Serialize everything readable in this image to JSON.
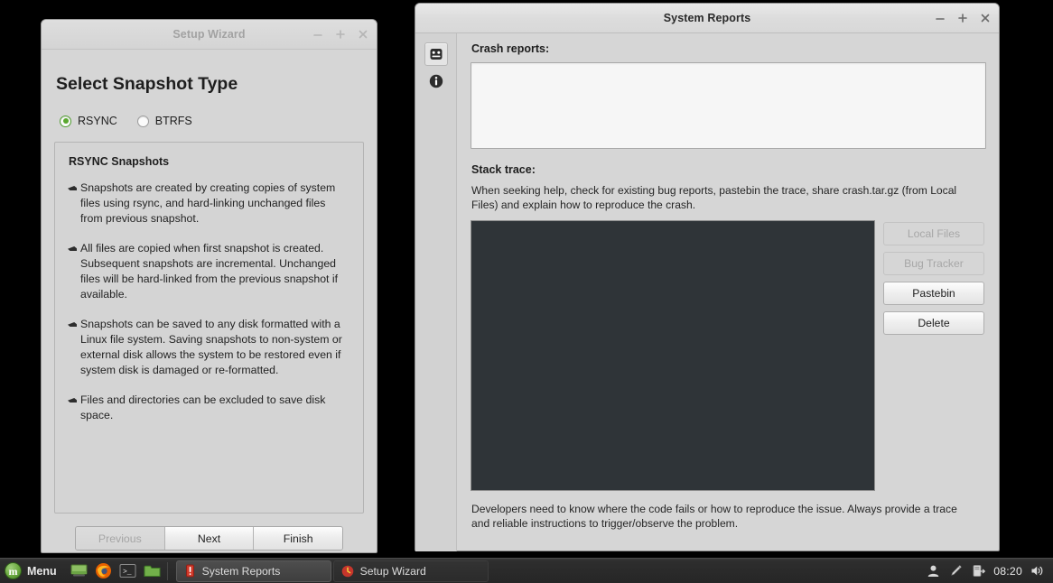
{
  "setup_wizard": {
    "title": "Setup Wizard",
    "heading": "Select Snapshot Type",
    "radios": [
      {
        "label": "RSYNC",
        "selected": true
      },
      {
        "label": "BTRFS",
        "selected": false
      }
    ],
    "info_title": "RSYNC Snapshots",
    "info_paragraphs": [
      "Snapshots are created by creating copies of system files using rsync, and hard-linking unchanged files from previous snapshot.",
      "All files are copied when first snapshot is created. Subsequent snapshots are incremental. Unchanged files will be hard-linked from the previous snapshot if available.",
      "Snapshots can be saved to any disk formatted with a Linux file system. Saving snapshots to non-system or external disk allows the system to be restored even if system disk is damaged or re-formatted.",
      "Files and directories can be excluded to save disk space."
    ],
    "buttons": [
      {
        "label": "Previous",
        "disabled": true
      },
      {
        "label": "Next",
        "disabled": false
      },
      {
        "label": "Finish",
        "disabled": false
      }
    ],
    "window_controls": {
      "minimize": "minimize-icon",
      "maximize": "maximize-icon",
      "close": "close-icon"
    }
  },
  "system_reports": {
    "title": "System Reports",
    "sidebar": [
      {
        "name": "crash-reports-icon",
        "selected": true
      },
      {
        "name": "info-icon",
        "selected": false
      }
    ],
    "crash_reports_label": "Crash reports:",
    "crash_reports_items": [],
    "stack_trace_label": "Stack trace:",
    "help_text": "When seeking help, check for existing bug reports, pastebin the trace, share crash.tar.gz (from Local Files) and explain how to reproduce the crash.",
    "trace_content": "",
    "buttons": [
      {
        "label": "Local Files",
        "disabled": true
      },
      {
        "label": "Bug Tracker",
        "disabled": true
      },
      {
        "label": "Pastebin",
        "disabled": false
      },
      {
        "label": "Delete",
        "disabled": false
      }
    ],
    "footer_text": "Developers need to know where the code fails or how to reproduce the issue. Always provide a trace and reliable instructions to trigger/observe the problem.",
    "window_controls": {
      "minimize": "minimize-icon",
      "maximize": "maximize-icon",
      "close": "close-icon"
    }
  },
  "taskbar": {
    "menu_label": "Menu",
    "mint_logo_letter": "m",
    "quick_launch": [
      {
        "name": "show-desktop-icon"
      },
      {
        "name": "firefox-icon"
      },
      {
        "name": "terminal-icon"
      },
      {
        "name": "file-manager-icon"
      }
    ],
    "tasks": [
      {
        "label": "System Reports",
        "icon": "warning-icon",
        "active": true
      },
      {
        "label": "Setup Wizard",
        "icon": "timeshift-icon",
        "active": false
      }
    ],
    "tray": [
      {
        "name": "user-icon"
      },
      {
        "name": "pen-icon"
      },
      {
        "name": "update-manager-icon"
      }
    ],
    "clock": "08:20",
    "volume_icon": "speaker-icon"
  },
  "colors": {
    "window_bg": "#d6d6d6",
    "taskbar_bg": "#2e2e2e",
    "trace_bg": "#2f3438",
    "accent_green": "#5aa82f",
    "warning_red": "#d03a2a"
  }
}
